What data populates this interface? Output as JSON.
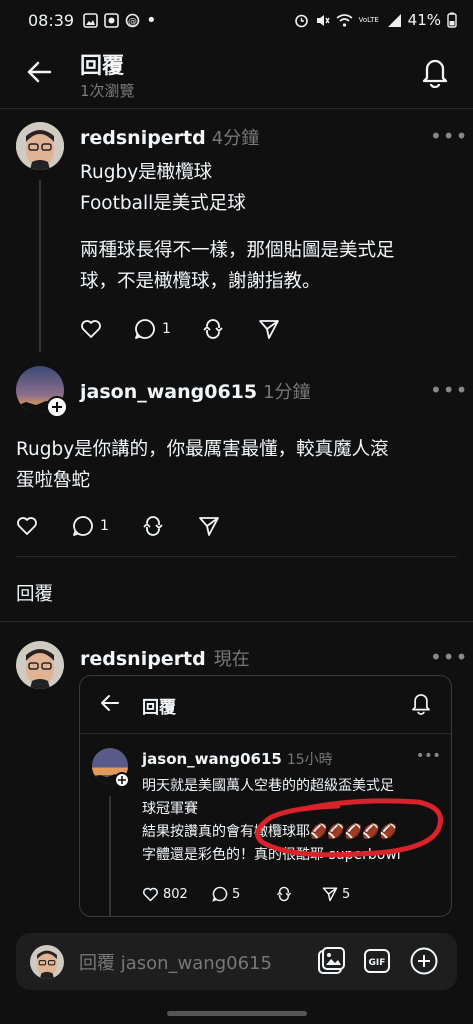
{
  "status_bar": {
    "time": "08:39",
    "battery": "41%",
    "network": "VoLTE"
  },
  "header": {
    "title": "回覆",
    "subtitle": "1次瀏覽"
  },
  "posts": [
    {
      "username": "redsnipertd",
      "time": "4分鐘",
      "lines": [
        "Rugby是橄欖球",
        "Football是美式足球"
      ],
      "paragraph2": [
        "兩種球長得不一樣，那個貼圖是美式足",
        "球，不是橄欖球，謝謝指教。"
      ],
      "reply_count": "1"
    },
    {
      "username": "jason_wang0615",
      "time": "1分鐘",
      "lines": [
        "Rugby是你講的，你最厲害最懂，較真魔人滾",
        "蛋啦魯蛇"
      ],
      "reply_count": "1"
    }
  ],
  "section_label": "回覆",
  "new_reply": {
    "username": "redsnipertd",
    "time": "現在"
  },
  "embed": {
    "title": "回覆",
    "username": "jason_wang0615",
    "time": "15小時",
    "lines": [
      "明天就是美國萬人空巷的的超級盃美式足",
      "球冠軍賽",
      "結果按讚真的會有橄欖球耶🏈🏈🏈🏈🏈",
      "字體還是彩色的！真的很酷耶 superbowl"
    ],
    "likes": "802",
    "comments": "5",
    "shares": "5",
    "highlight_color": "#d8232a"
  },
  "reply_bar": {
    "placeholder": "回覆 jason_wang0615"
  },
  "colors": {
    "background": "#101010",
    "text": "#f3f5f7",
    "muted": "#777777",
    "divider": "#2a2a2a"
  }
}
